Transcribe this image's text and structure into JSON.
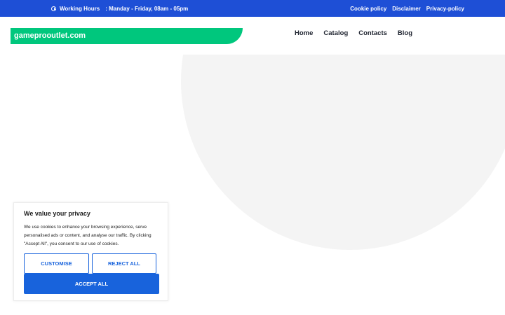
{
  "topbar": {
    "hours_label": "Working Hours",
    "hours_value": ": Manday - Friday, 08am - 05pm",
    "links": [
      "Cookie policy",
      "Disclaimer",
      "Privacy-policy"
    ]
  },
  "header": {
    "logo_text": "gameprooutlet.com",
    "nav": [
      "Home",
      "Catalog",
      "Contacts",
      "Blog"
    ]
  },
  "cookie_banner": {
    "title": "We value your privacy",
    "body": "We use cookies to enhance your browsing experience, serve personalised ads or content, and analyse our traffic. By clicking \"Accept All\", you consent to our use of cookies.",
    "customise_label": "CUSTOMISE",
    "reject_label": "REJECT ALL",
    "accept_label": "ACCEPT ALL"
  },
  "colors": {
    "topbar_bg": "#1e4fd6",
    "logo_bg": "#00c77d",
    "accent": "#1863dc",
    "hero_shape": "#f4f4f4"
  },
  "icons": {
    "hours": "clock-icon"
  }
}
